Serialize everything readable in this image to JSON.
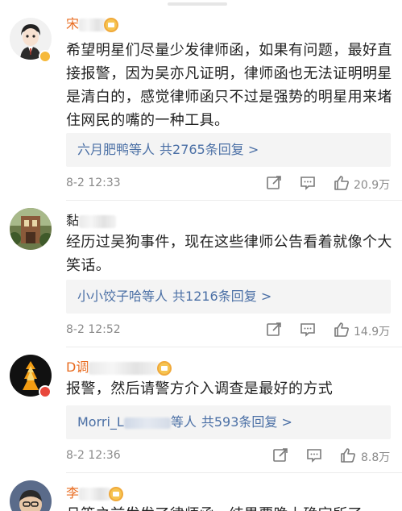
{
  "comments": [
    {
      "username": "宋",
      "text": "希望明星们尽量少发律师函，如果有问题，最好直接报警，因为吴亦凡证明，律师函也无法证明明星是清白的，感觉律师函只不过是强势的明星用来堵住网民的嘴的一种工具。",
      "replies_users": "六月肥鸭等人",
      "replies_count": "共2765条回复 >",
      "time": "8-2 12:33",
      "likes": "20.9万"
    },
    {
      "username": "黏",
      "text": "经历过吴狗事件，现在这些律师公告看着就像个大笑话。",
      "replies_users": "小小饺子哈等人",
      "replies_count": "共1216条回复 >",
      "time": "8-2 12:52",
      "likes": "14.9万"
    },
    {
      "username": "D调",
      "text": "报警，然后请警方介入调查是最好的方式",
      "replies_users_prefix": "Morri_L",
      "replies_users": "等人",
      "replies_count": "共593条回复 >",
      "time": "8-2 12:36",
      "likes": "8.8万"
    },
    {
      "username": "李",
      "text": "且等之前发发了律师函，结果要晚上确定所了"
    }
  ],
  "icons": {
    "share": "share-icon",
    "comment": "comment-icon",
    "like": "thumbs-up-icon",
    "vip": "crown-badge-icon",
    "verified": "verified-badge-icon"
  },
  "colors": {
    "link": "#4a6fa5",
    "vip_name": "#e86b1f",
    "text": "#222222",
    "meta": "#8a8a8a",
    "reply_bg": "#f4f4f4"
  }
}
